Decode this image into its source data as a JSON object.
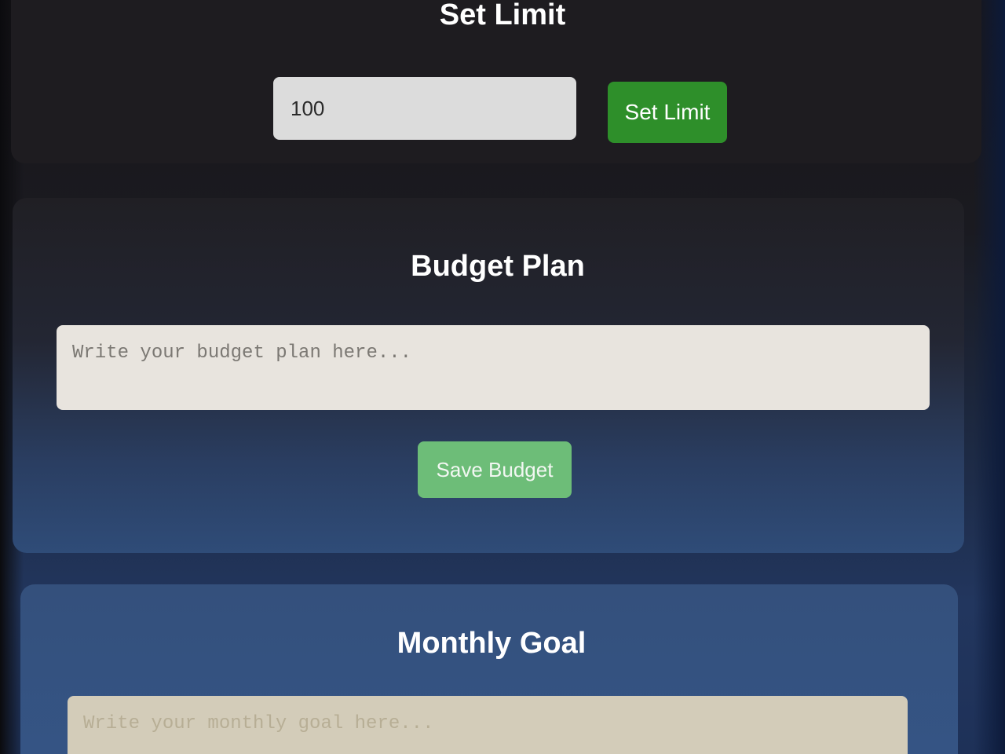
{
  "limit_section": {
    "title": "Set Limit",
    "input_value": "100",
    "button_label": "Set Limit"
  },
  "budget_section": {
    "title": "Budget Plan",
    "placeholder": "Write your budget plan here...",
    "button_label": "Save Budget"
  },
  "goal_section": {
    "title": "Monthly Goal",
    "placeholder": "Write your monthly goal here..."
  },
  "colors": {
    "set_limit_button": "#2e8f2a",
    "save_budget_button": "#6dbd78",
    "background_top": "#18161a",
    "background_bottom": "#22365e"
  }
}
